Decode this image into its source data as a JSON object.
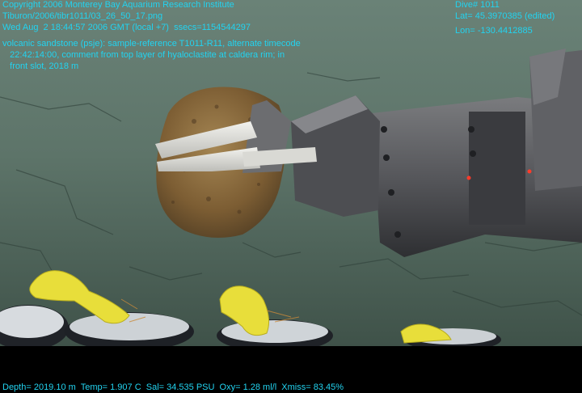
{
  "overlay": {
    "copyright": "Copyright 2006 Monterey Bay Aquarium Research Institute",
    "filename": "Tiburon/2006/tibr1011/03_26_50_17.png",
    "timestamp": "Wed Aug  2 18:44:57 2006 GMT (local +7)  ssecs=1154544297",
    "comment": "volcanic sandstone (psje): sample-reference T1011-R11, alternate timecode\n   22:42:14:00, comment from top layer of hyaloclastite at caldera rim; in\n   front slot, 2018 m",
    "dive": "Dive# 1011",
    "lat": "Lat= 45.3970385 (edited)",
    "lon": "Lon= -130.4412885",
    "sensors": "Depth= 2019.10 m  Temp= 1.907 C  Sal= 34.535 PSU  Oxy= 1.28 ml/l  Xmiss= 83.45%"
  },
  "colors": {
    "overlay_text": "#22d3f0",
    "seafloor": "#5c7168",
    "rope": "#e8de3a",
    "rock": "#8a6a3c",
    "manipulator": "#55565a"
  }
}
